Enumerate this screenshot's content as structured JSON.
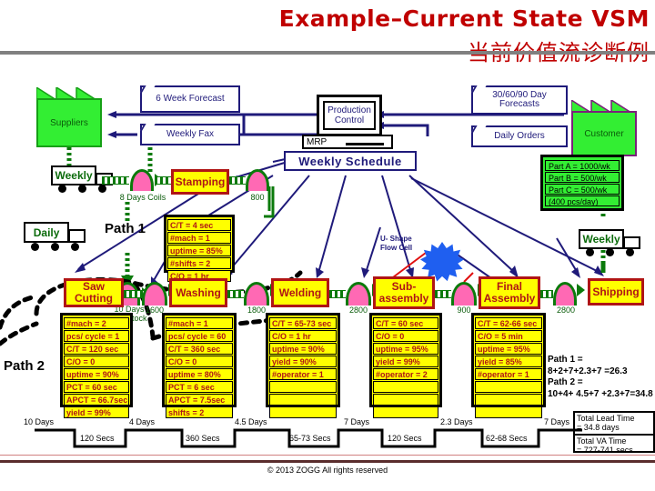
{
  "title": {
    "english": "Example–Current State VSM",
    "chinese": "当前价值流诊断例"
  },
  "footer": {
    "copyright": "© 2013 ZOGG  All rights reserved"
  },
  "entities": {
    "supplier": "Suppliers",
    "customer": "Customer",
    "production_control_line1": "Production",
    "production_control_line2": "Control",
    "mrp": "MRP"
  },
  "info_boxes": {
    "six_week_forecast": "6 Week        Forecast",
    "weekly_fax": "Weekly Fax",
    "day_forecasts": "30/60/90 Day\nForecasts",
    "daily_orders": "Daily Orders",
    "weekly_schedule": "Weekly Schedule"
  },
  "trucks": {
    "inbound_weekly": "Weekly",
    "inbound_daily": "Daily",
    "outbound_weekly": "Weekly"
  },
  "part_list": [
    "Part A = 1000/wk",
    "Part B = 500/wk",
    "Part C = 500/wk",
    "(400 pcs/day)"
  ],
  "kaizen": {
    "label_line1": "U- Shape",
    "label_line2": "Flow Cell"
  },
  "paths": {
    "path1_label": "Path 1",
    "path2_label": "Path 2"
  },
  "path_summary": {
    "line1": "Path 1 =",
    "line2": "8+2+7+2.3+7 =26.3",
    "line3": "Path 2 =",
    "line4": "10+4+ 4.5+7 +2.3+7=34.8"
  },
  "totals": {
    "lead_time_label": "Total Lead  Time",
    "lead_time_value": "= 34.8 days",
    "va_time_label": "Total VA Time",
    "va_time_value": "= 727-741 secs"
  },
  "inventories": [
    {
      "name": "coils",
      "label": "8 Days Coils",
      "count": ""
    },
    {
      "name": "stamping-out",
      "label": "",
      "count": "800"
    },
    {
      "name": "bar-stock",
      "label": "10 Days\nBar Stock",
      "count": ""
    },
    {
      "name": "saw-out",
      "label": "",
      "count": "1600"
    },
    {
      "name": "washing-out",
      "label": "",
      "count": "1800"
    },
    {
      "name": "welding-out",
      "label": "",
      "count": "2800"
    },
    {
      "name": "subassembly-out",
      "label": "",
      "count": "900"
    },
    {
      "name": "final-out",
      "label": "",
      "count": "2800"
    }
  ],
  "processes": [
    {
      "id": "stamping",
      "name": "Stamping",
      "data": [
        "C/T = 4 sec",
        "#mach = 1",
        "uptime = 85%",
        "#shifts = 2",
        "C/O = 1 hr"
      ]
    },
    {
      "id": "saw-cutting",
      "name": "Saw\nCutting",
      "data": [
        "#mach = 2",
        "pcs/ cycle = 1",
        "C/T = 120 sec",
        "C/O = 0",
        "uptime = 90%",
        "PCT = 60 sec",
        "APCT = 66.7sec",
        "yield = 99%"
      ]
    },
    {
      "id": "washing",
      "name": "Washing",
      "data": [
        "#mach = 1",
        "pcs/ cycle = 60",
        "C/T = 360 sec",
        "C/O = 0",
        "uptime = 80%",
        "PCT = 6 sec",
        "APCT = 7.5sec",
        "shifts = 2"
      ]
    },
    {
      "id": "welding",
      "name": "Welding",
      "data": [
        "C/T = 65-73 sec",
        "C/O = 1 hr",
        "uptime = 90%",
        "yield = 90%",
        "#operator = 1",
        "",
        "",
        ""
      ]
    },
    {
      "id": "sub-assembly",
      "name": "Sub-\nassembly",
      "data": [
        "C/T = 60 sec",
        "C/O = 0",
        "uptime = 95%",
        "yield = 99%",
        "#operator = 2",
        "",
        "",
        ""
      ]
    },
    {
      "id": "final-assembly",
      "name": "Final\nAssembly",
      "data": [
        "C/T = 62-66 sec",
        "C/O = 5 min",
        "uptime = 95%",
        "yield = 85%",
        "#operator = 1",
        "",
        "",
        ""
      ]
    },
    {
      "id": "shipping",
      "name": "Shipping",
      "data": []
    }
  ],
  "timeline": {
    "lead_times": [
      "10 Days",
      "4 Days",
      "4.5 Days",
      "7 Days",
      "2.3 Days",
      "7 Days"
    ],
    "process_times": [
      "120 Secs",
      "360 Secs",
      "65-73 Secs",
      "120 Secs",
      "62-68 Secs"
    ]
  },
  "colors": {
    "title_red": "#c00000",
    "process_fill": "#ffff00",
    "process_border": "#b01515",
    "inventory_fill": "#ff69b4",
    "entity_green": "#33ee33",
    "arrow_blue": "#1f1a7a",
    "kaizen_blue": "#1f5ff0"
  }
}
